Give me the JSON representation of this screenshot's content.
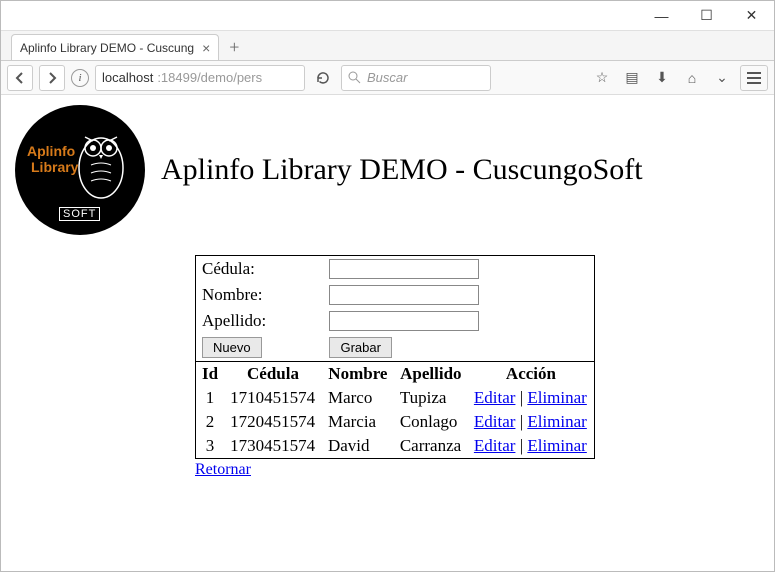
{
  "window": {
    "tab_title": "Aplinfo Library DEMO - Cuscung",
    "url_host": "localhost",
    "url_rest": ":18499/demo/pers",
    "search_placeholder": "Buscar"
  },
  "logo": {
    "line1": "Aplinfo",
    "line2": "Library",
    "soft": "SOFT"
  },
  "page": {
    "title": "Aplinfo Library DEMO - CuscungoSoft"
  },
  "form": {
    "cedula_label": "Cédula:",
    "nombre_label": "Nombre:",
    "apellido_label": "Apellido:",
    "cedula_value": "",
    "nombre_value": "",
    "apellido_value": "",
    "nuevo_label": "Nuevo",
    "grabar_label": "Grabar"
  },
  "table": {
    "headers": {
      "id": "Id",
      "cedula": "Cédula",
      "nombre": "Nombre",
      "apellido": "Apellido",
      "accion": "Acción"
    },
    "action_edit": "Editar",
    "action_sep": " | ",
    "action_delete": "Eliminar",
    "rows": [
      {
        "id": "1",
        "cedula": "1710451574",
        "nombre": "Marco",
        "apellido": "Tupiza"
      },
      {
        "id": "2",
        "cedula": "1720451574",
        "nombre": "Marcia",
        "apellido": "Conlago"
      },
      {
        "id": "3",
        "cedula": "1730451574",
        "nombre": "David",
        "apellido": "Carranza"
      }
    ]
  },
  "links": {
    "retornar": "Retornar"
  }
}
